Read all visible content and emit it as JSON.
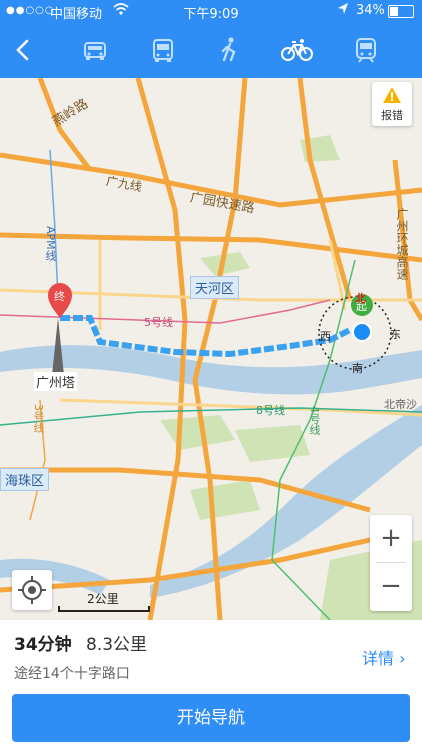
{
  "status_bar": {
    "signal": "●●○○○",
    "carrier": "中国移动",
    "time": "下午9:09",
    "battery": "34%"
  },
  "top_bar": {
    "back_icon": "chevron-left-icon",
    "modes": [
      {
        "name": "car",
        "icon": "car-icon"
      },
      {
        "name": "bus",
        "icon": "bus-icon"
      },
      {
        "name": "walk",
        "icon": "walk-icon"
      },
      {
        "name": "bike",
        "icon": "bike-icon",
        "active": true
      },
      {
        "name": "train",
        "icon": "train-icon"
      }
    ]
  },
  "map": {
    "labels": {
      "yanling_road": "燕岭路",
      "guangjiu": "广九线",
      "guangyuan": "广园快速路",
      "apm": "APM线",
      "line5": "5号线",
      "line8": "8号线",
      "line3": "3号线",
      "line4": "4号线",
      "guangzhou_ring": "广州环城高速",
      "beidisha": "北帝沙",
      "canton_tower": "广州塔"
    },
    "districts": {
      "tianhe": "天河区",
      "haizhu": "海珠区"
    },
    "markers": {
      "end": "终",
      "start": "起"
    },
    "compass": {
      "north": "北",
      "south": "南",
      "east": "东",
      "west": "西"
    },
    "report_label": "报错",
    "zoom_in": "+",
    "zoom_out": "−",
    "scale": "2公里"
  },
  "route": {
    "duration": "34分钟",
    "distance": "8.3公里",
    "via": "途经14个十字路口",
    "detail": "详情 ›",
    "start_navigation": "开始导航"
  },
  "colors": {
    "primary": "#2f8df6",
    "route": "#3aa0f0",
    "river": "#b3cfe6",
    "road": "#f4a53c"
  }
}
